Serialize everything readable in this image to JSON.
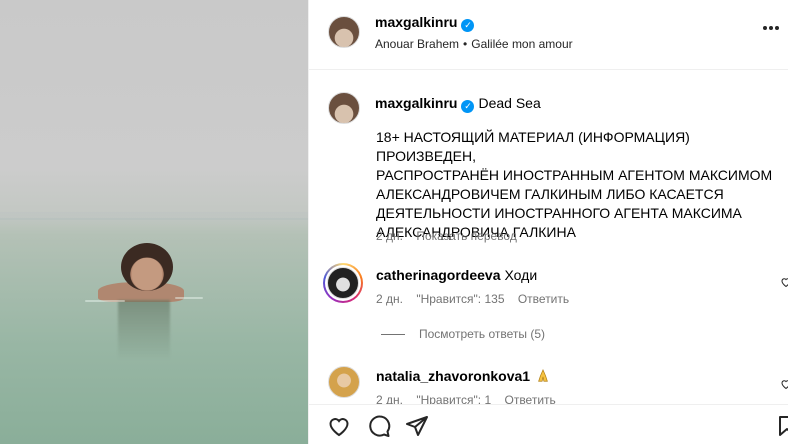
{
  "post": {
    "username": "maxgalkinru",
    "audio_artist": "Anouar Brahem",
    "audio_separator": "•",
    "audio_track": "Galilée mon amour"
  },
  "caption": {
    "username": "maxgalkinru",
    "location": "Dead Sea",
    "text": "18+ НАСТОЯЩИЙ МАТЕРИАЛ (ИНФОРМАЦИЯ) ПРОИЗВЕДЕН,\nРАСПРОСТРАНЁН ИНОСТРАННЫМ АГЕНТОМ МАКСИМОМ\nАЛЕКСАНДРОВИЧЕМ ГАЛКИНЫМ ЛИБО КАСАЕТСЯ\nДЕЯТЕЛЬНОСТИ ИНОСТРАННОГО АГЕНТА МАКСИМА\nАЛЕКСАНДРОВИЧА ГАЛКИНА",
    "time": "2 дн.",
    "translate": "Показать перевод"
  },
  "comments": [
    {
      "username": "catherinagordeeva",
      "text": "Ходи",
      "time": "2 дн.",
      "likes": "\"Нравится\": 135",
      "reply": "Ответить",
      "view_replies": "Посмотреть ответы (5)"
    },
    {
      "username": "natalia_zhavoronkova1",
      "text": "",
      "time": "2 дн.",
      "likes": "\"Нравится\": 1",
      "reply": "Ответить"
    }
  ],
  "icons": {
    "verified": "verified-badge-icon",
    "more": "more-horizontal-icon",
    "like": "heart-icon",
    "comment": "comment-icon",
    "share": "share-icon",
    "save": "bookmark-icon"
  },
  "colors": {
    "verified": "#0095f6",
    "secondary_text": "#737373"
  }
}
